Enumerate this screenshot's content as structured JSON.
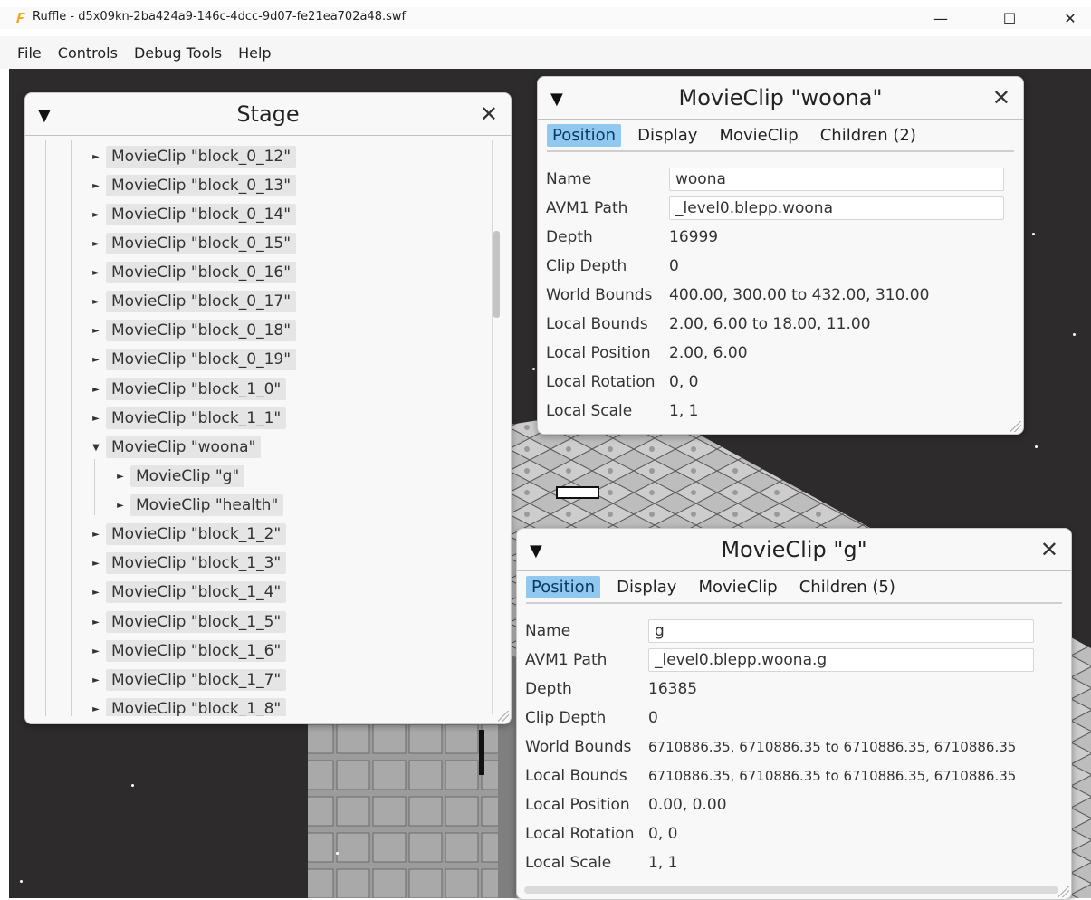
{
  "window": {
    "title": "Ruffle - d5x09kn-2ba424a9-146c-4dcc-9d07-fe21ea702a48.swf",
    "minimize": "—",
    "maximize": "☐",
    "close": "✕"
  },
  "menu": [
    "File",
    "Controls",
    "Debug Tools",
    "Help"
  ],
  "stage_window": {
    "title": "Stage",
    "collapse": "▼",
    "close": "✕",
    "nodes": [
      {
        "arrow": "►",
        "label": "MovieClip \"block_0_12\""
      },
      {
        "arrow": "►",
        "label": "MovieClip \"block_0_13\""
      },
      {
        "arrow": "►",
        "label": "MovieClip \"block_0_14\""
      },
      {
        "arrow": "►",
        "label": "MovieClip \"block_0_15\""
      },
      {
        "arrow": "►",
        "label": "MovieClip \"block_0_16\""
      },
      {
        "arrow": "►",
        "label": "MovieClip \"block_0_17\""
      },
      {
        "arrow": "►",
        "label": "MovieClip \"block_0_18\""
      },
      {
        "arrow": "►",
        "label": "MovieClip \"block_0_19\""
      },
      {
        "arrow": "►",
        "label": "MovieClip \"block_1_0\""
      },
      {
        "arrow": "►",
        "label": "MovieClip \"block_1_1\""
      },
      {
        "arrow": "▼",
        "label": "MovieClip \"woona\""
      },
      {
        "arrow": "►",
        "label": "MovieClip \"g\""
      },
      {
        "arrow": "►",
        "label": "MovieClip \"health\""
      },
      {
        "arrow": "►",
        "label": "MovieClip \"block_1_2\""
      },
      {
        "arrow": "►",
        "label": "MovieClip \"block_1_3\""
      },
      {
        "arrow": "►",
        "label": "MovieClip \"block_1_4\""
      },
      {
        "arrow": "►",
        "label": "MovieClip \"block_1_5\""
      },
      {
        "arrow": "►",
        "label": "MovieClip \"block_1_6\""
      },
      {
        "arrow": "►",
        "label": "MovieClip \"block_1_7\""
      },
      {
        "arrow": "►",
        "label": "MovieClip \"block_1_8\""
      }
    ]
  },
  "woona_window": {
    "title": "MovieClip \"woona\"",
    "collapse": "▼",
    "close": "✕",
    "tabs": [
      "Position",
      "Display",
      "MovieClip",
      "Children (2)"
    ],
    "props": {
      "name_label": "Name",
      "name_value": "woona",
      "avm1_label": "AVM1 Path",
      "avm1_value": "_level0.blepp.woona",
      "depth_label": "Depth",
      "depth_value": "16999",
      "clipdepth_label": "Clip Depth",
      "clipdepth_value": "0",
      "world_label": "World Bounds",
      "world_value": "400.00, 300.00 to 432.00, 310.00",
      "local_label": "Local Bounds",
      "local_value": "2.00, 6.00 to 18.00, 11.00",
      "localpos_label": "Local Position",
      "localpos_value": "2.00, 6.00",
      "localrot_label": "Local Rotation",
      "localrot_value": "0, 0",
      "localscale_label": "Local Scale",
      "localscale_value": "1, 1"
    }
  },
  "g_window": {
    "title": "MovieClip \"g\"",
    "collapse": "▼",
    "close": "✕",
    "tabs": [
      "Position",
      "Display",
      "MovieClip",
      "Children (5)"
    ],
    "props": {
      "name_label": "Name",
      "name_value": "g",
      "avm1_label": "AVM1 Path",
      "avm1_value": "_level0.blepp.woona.g",
      "depth_label": "Depth",
      "depth_value": "16385",
      "clipdepth_label": "Clip Depth",
      "clipdepth_value": "0",
      "world_label": "World Bounds",
      "world_value": "6710886.35, 6710886.35 to 6710886.35, 6710886.35",
      "local_label": "Local Bounds",
      "local_value": "6710886.35, 6710886.35 to 6710886.35, 6710886.35",
      "localpos_label": "Local Position",
      "localpos_value": "0.00, 0.00",
      "localrot_label": "Local Rotation",
      "localrot_value": "0, 0",
      "localscale_label": "Local Scale",
      "localscale_value": "1, 1"
    }
  },
  "colors": {
    "game_bg": "#2d2b2c",
    "active_tab": "#90c8f0",
    "ruffle_icon": "#f7a51c"
  }
}
